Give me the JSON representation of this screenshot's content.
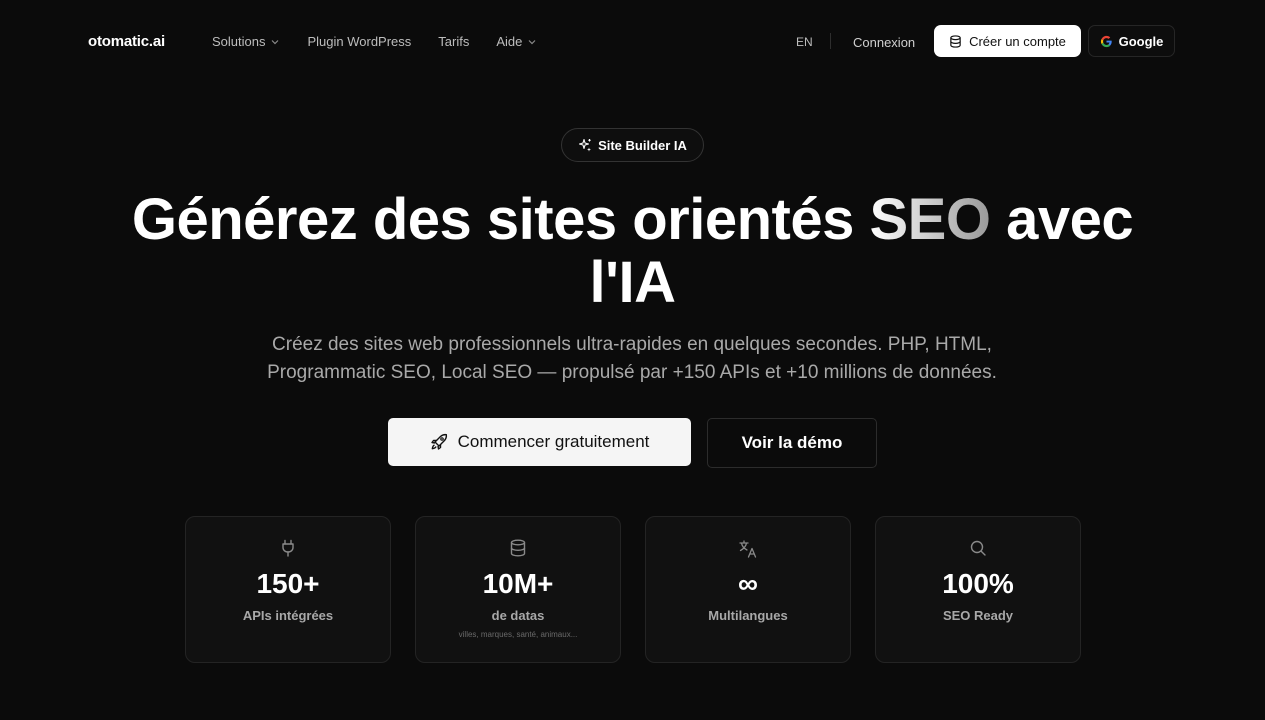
{
  "nav": {
    "logo": "otomatic.ai",
    "links": [
      {
        "label": "Solutions",
        "dropdown": true
      },
      {
        "label": "Plugin WordPress",
        "dropdown": false
      },
      {
        "label": "Tarifs",
        "dropdown": false
      },
      {
        "label": "Aide",
        "dropdown": true
      }
    ],
    "language": "EN",
    "login": "Connexion",
    "create_account": "Créer un compte",
    "google": "Google"
  },
  "hero": {
    "badge": "Site Builder IA",
    "title_part1": "Générez des sites orientés ",
    "title_highlight": "SEO",
    "title_part2": " avec",
    "title_line2": "l'IA",
    "subtitle_line1": "Créez des sites web professionnels ultra-rapides en quelques secondes. PHP, HTML,",
    "subtitle_line2": "Programmatic SEO, Local SEO — propulsé par +150 APIs et +10 millions de données.",
    "cta_primary": "Commencer gratuitement",
    "cta_secondary": "Voir la démo"
  },
  "stats": [
    {
      "icon": "plug-icon",
      "value": "150+",
      "label": "APIs intégrées",
      "note": ""
    },
    {
      "icon": "database-icon",
      "value": "10M+",
      "label": "de datas",
      "note": "villes, marques, santé, animaux..."
    },
    {
      "icon": "translate-icon",
      "value": "∞",
      "label": "Multilangues",
      "note": ""
    },
    {
      "icon": "search-icon",
      "value": "100%",
      "label": "SEO Ready",
      "note": ""
    }
  ],
  "colors": {
    "background": "#0b0b0b",
    "card": "#111111",
    "primary_button": "#f5f5f5",
    "muted_text": "#a9a9a9"
  }
}
